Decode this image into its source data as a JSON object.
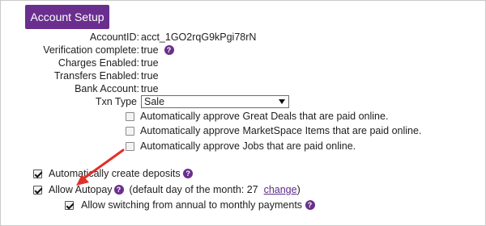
{
  "header": {
    "button_label": "Account Setup"
  },
  "details": {
    "account_id_label": "AccountID:",
    "account_id_value": "acct_1GO2rqG9kPgi78rN",
    "verification_label": "Verification complete:",
    "verification_value": "true",
    "charges_label": "Charges Enabled:",
    "charges_value": "true",
    "transfers_label": "Transfers Enabled:",
    "transfers_value": "true",
    "bank_label": "Bank Account:",
    "bank_value": "true",
    "txn_label": "Txn Type",
    "txn_selected": "Sale"
  },
  "auto_approve": {
    "great_deals": "Automatically approve Great Deals that are paid online.",
    "marketspace": "Automatically approve MarketSpace Items that are paid online.",
    "jobs": "Automatically approve Jobs that are paid online."
  },
  "options": {
    "deposits_label": "Automatically create deposits",
    "autopay_label": "Allow Autopay",
    "autopay_note": "(default day of the month: 27",
    "change_link": "change",
    "autopay_note_close": ")",
    "switching_label": "Allow switching from annual to monthly payments"
  },
  "help_glyph": "?",
  "colors": {
    "accent": "#6a2f8e",
    "annotation_arrow": "#e0302a"
  }
}
